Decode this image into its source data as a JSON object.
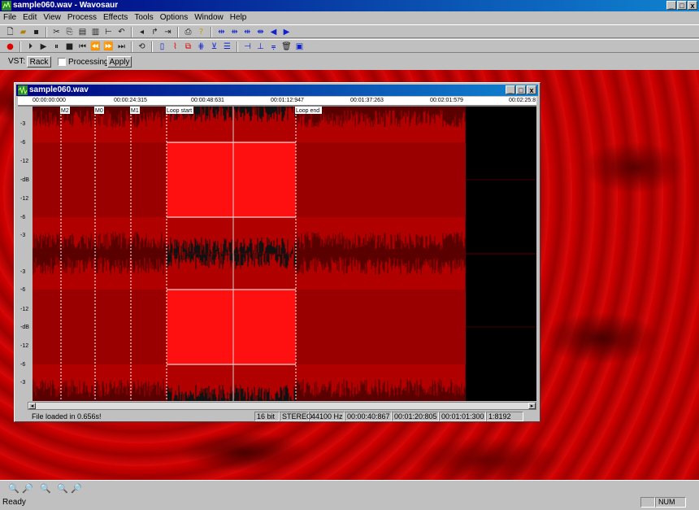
{
  "app": {
    "title": "sample060.wav - Wavosaur",
    "window_buttons": [
      "_",
      "□",
      "x"
    ]
  },
  "menu": [
    "File",
    "Edit",
    "View",
    "Process",
    "Effects",
    "Tools",
    "Options",
    "Window",
    "Help"
  ],
  "toolbar1": [
    "new-icon",
    "open-icon",
    "save-icon",
    "cut-icon",
    "copy-icon",
    "paste-icon",
    "paste-special-icon",
    "trim-icon",
    "undo-icon",
    "normalize-icon",
    "redo-icon",
    "loop-icon",
    "print-icon",
    "help-icon",
    "marker-icon",
    "split-icon",
    "join-icon",
    "fade-icon",
    "back-icon",
    "forward-icon"
  ],
  "toolbar2": [
    "record-icon",
    "play-from-start-icon",
    "play-icon",
    "pause-icon",
    "stop-icon",
    "prev-icon",
    "rewind-icon",
    "fast-forward-icon",
    "next-icon",
    "loop-play-icon"
  ],
  "vst": {
    "label": "VST:",
    "rack": "Rack",
    "processing": "Processing",
    "apply": "Apply"
  },
  "child": {
    "title": "sample060.wav",
    "ruler": [
      "00:00:00:000",
      "00:00:24:315",
      "00:00:48:631",
      "00:01:12:947",
      "00:01:37:263",
      "00:02:01:579",
      "00:02:25:8"
    ],
    "scale_top": [
      "-3",
      "-6",
      "-12",
      "-dB",
      "-12",
      "-6",
      "-3"
    ],
    "scale_bottom": [
      "-3",
      "-6",
      "-12",
      "-dB",
      "-12",
      "-6",
      "-3"
    ],
    "markers": [
      "M2",
      "M0",
      "M1",
      "Loop start",
      "Loop end"
    ],
    "status": {
      "message": "File loaded in 0.656s!",
      "bits": "16 bit",
      "channels": "STEREO",
      "rate": "44100 Hz",
      "sel_start": "00:00:40:867",
      "sel_end": "00:01:20:805",
      "sel_len": "00:01:01:300",
      "zoom": "1:8192"
    }
  },
  "status": {
    "text": "Ready",
    "num": "NUM"
  }
}
